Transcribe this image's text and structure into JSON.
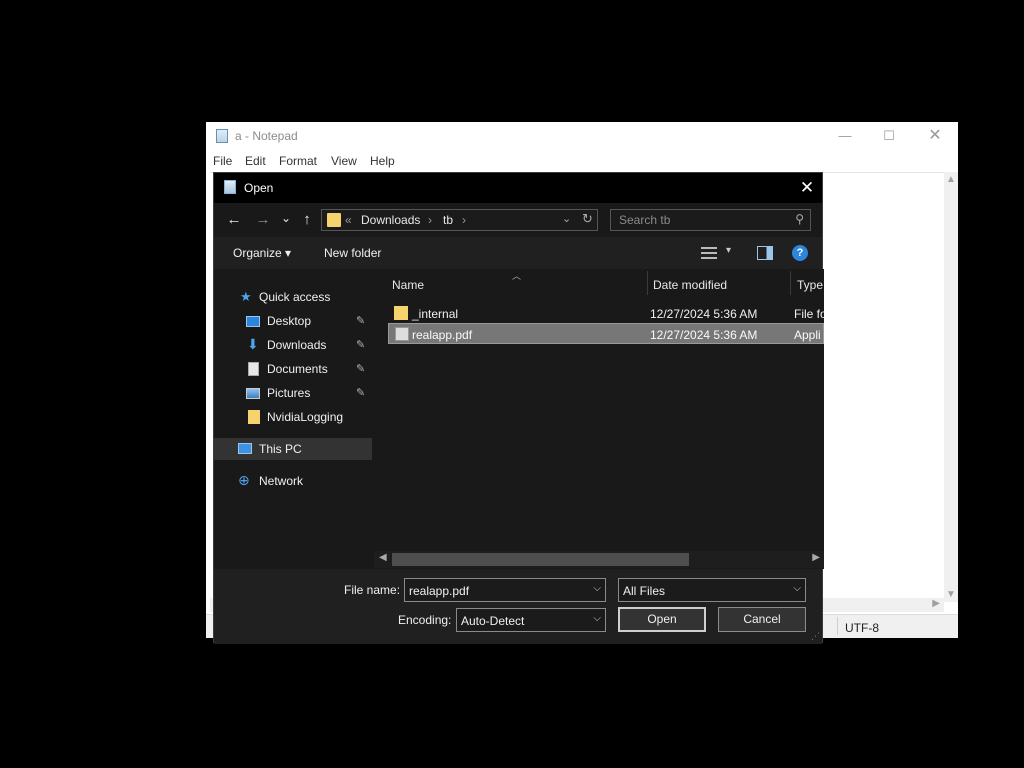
{
  "notepad": {
    "title": "a - Notepad",
    "controls": {
      "minimize": "—",
      "maximize": "☐",
      "close": "✕"
    },
    "menu": [
      "File",
      "Edit",
      "Format",
      "View",
      "Help"
    ],
    "status_encoding": "UTF-8"
  },
  "dialog": {
    "title": "Open",
    "close_glyph": "✕",
    "nav": {
      "back": "←",
      "forward": "→",
      "recent": "⌄",
      "up": "↑"
    },
    "breadcrumb": [
      "«",
      "Downloads",
      "›",
      "tb",
      "›"
    ],
    "search_placeholder": "Search tb",
    "toolbar": {
      "organize": "Organize ▾",
      "new_folder": "New folder",
      "view_dropdown": "▾",
      "help": "?"
    },
    "nav_pane": [
      {
        "label": "Quick access",
        "icon": "star-icon",
        "pinned": false
      },
      {
        "label": "Desktop",
        "icon": "desktop-icon",
        "pinned": true
      },
      {
        "label": "Downloads",
        "icon": "download-icon",
        "pinned": true
      },
      {
        "label": "Documents",
        "icon": "documents-icon",
        "pinned": true
      },
      {
        "label": "Pictures",
        "icon": "pictures-icon",
        "pinned": true
      },
      {
        "label": "NvidiaLogging",
        "icon": "folder-icon",
        "pinned": false
      },
      {
        "label": "This PC",
        "icon": "computer-icon",
        "pinned": false,
        "selected": true
      },
      {
        "label": "Network",
        "icon": "network-icon",
        "pinned": false
      }
    ],
    "pin_glyph": "📌",
    "columns": {
      "name": "Name",
      "date_modified": "Date modified",
      "type": "Type"
    },
    "files": [
      {
        "name": "_internal",
        "date": "12/27/2024 5:36 AM",
        "type": "File fo",
        "icon": "folder-icon",
        "selected": false
      },
      {
        "name": "realapp.pdf",
        "date": "12/27/2024 5:36 AM",
        "type": "Appli",
        "icon": "application-icon",
        "selected": true
      }
    ],
    "file_name_label": "File name:",
    "file_name_value": "realapp.pdf",
    "file_type_value": "All Files",
    "encoding_label": "Encoding:",
    "encoding_value": "Auto-Detect",
    "open_label": "Open",
    "cancel_label": "Cancel"
  },
  "colors": {
    "dialog_bg": "#202020",
    "selection": "#777777",
    "accent": "#2b86dc",
    "folder": "#f6d36c"
  }
}
